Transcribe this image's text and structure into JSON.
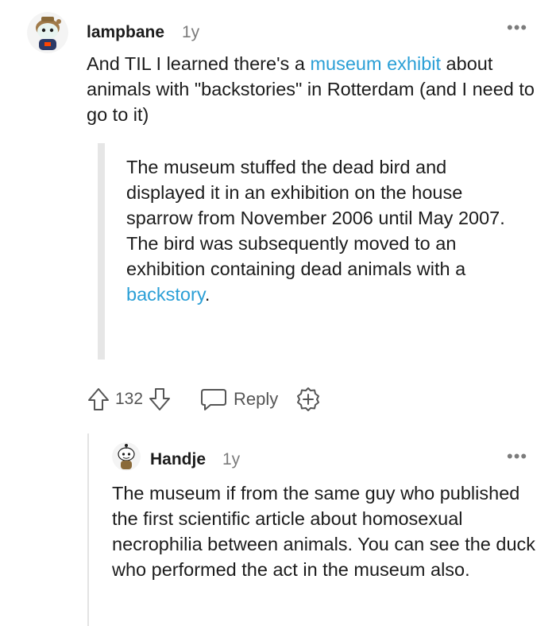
{
  "comments": [
    {
      "author": "lampbane",
      "age": "1y",
      "more": "•••",
      "body": {
        "prefix": "And TIL I learned there's a ",
        "link": "museum exhibit",
        "suffix": " about animals with \"backstories\" in Rotterdam (and I need to go to it)"
      },
      "quote": {
        "prefix": "The museum stuffed the dead bird and displayed it in an exhibition on the house sparrow from November 2006 until May 2007. The bird was subsequently moved to an exhibition containing dead animals with a ",
        "link": "backstory",
        "suffix": "."
      },
      "vote_count": "132",
      "reply_label": "Reply"
    },
    {
      "author": "Handje",
      "age": "1y",
      "more": "•••",
      "body": "The museum if from the same guy who published the first scientific article about homosexual necrophilia between animals. You can see the duck who performed the act in the museum also."
    }
  ],
  "colors": {
    "link": "#2a9fd6",
    "muted": "#7c7c7c",
    "text": "#1c1c1c"
  }
}
